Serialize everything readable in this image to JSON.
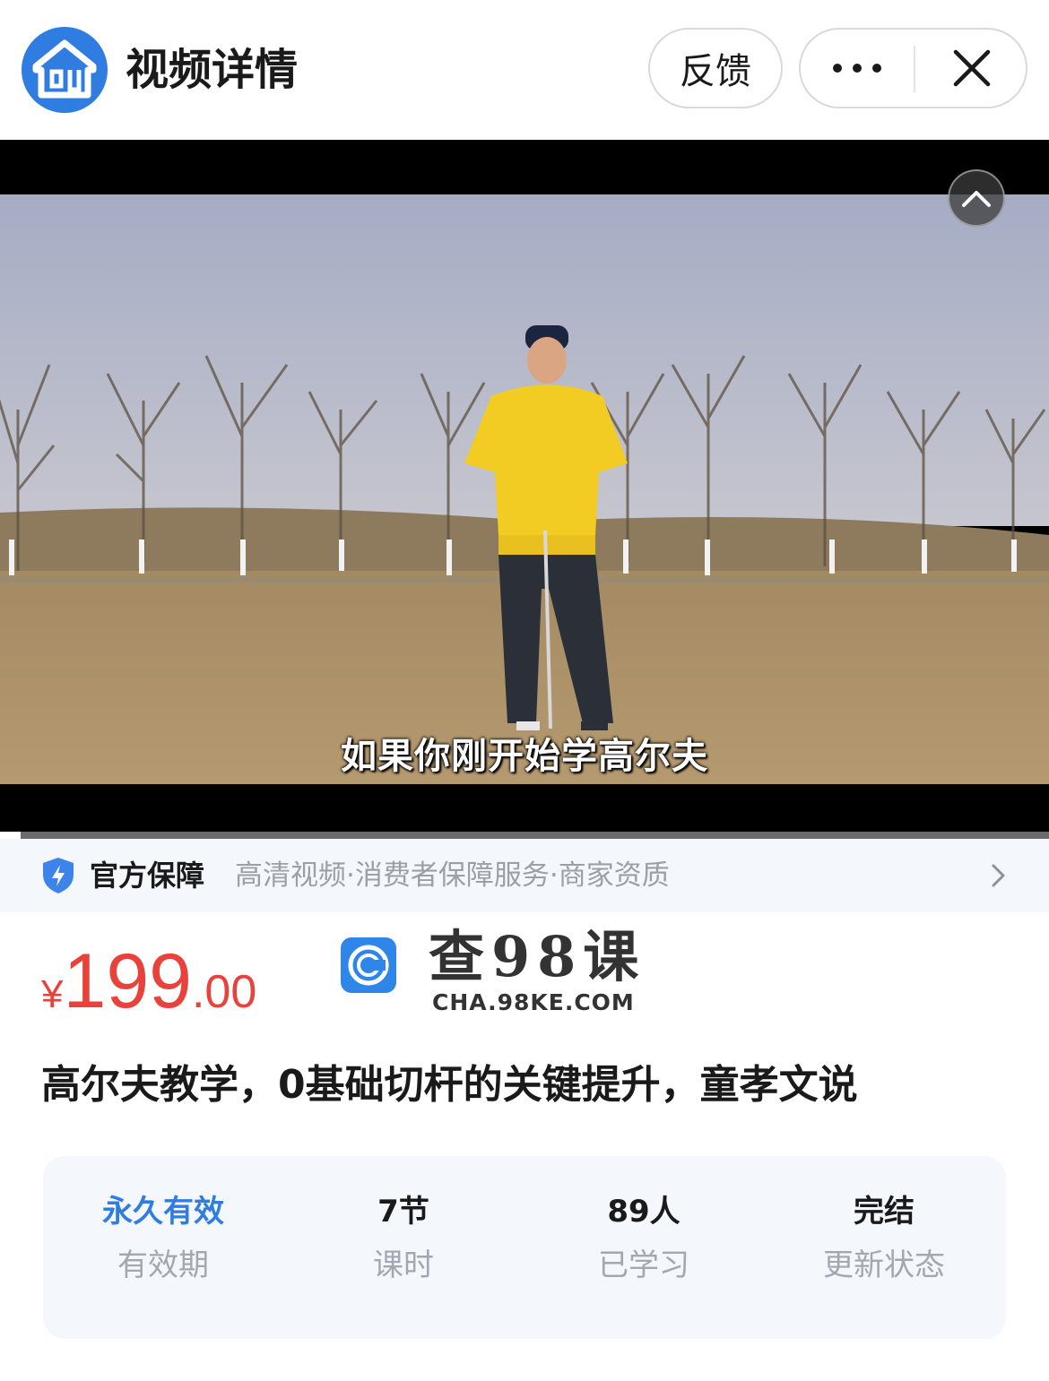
{
  "header": {
    "title": "视频详情",
    "feedback_label": "反馈"
  },
  "video": {
    "subtitle": "如果你刚开始学高尔夫",
    "progress_fraction": 0.02
  },
  "guarantee": {
    "title": "官方保障",
    "items": "高清视频·消费者保障服务·商家资质"
  },
  "price": {
    "currency": "¥",
    "integer": "199",
    "decimal": ".00"
  },
  "watermark": {
    "name": "查98课",
    "url": "CHA.98KE.COM"
  },
  "course": {
    "title": "高尔夫教学，0基础切杆的关键提升，童孝文说"
  },
  "stats": [
    {
      "value": "永久有效",
      "label": "有效期"
    },
    {
      "value": "7节",
      "label": "课时"
    },
    {
      "value": "89人",
      "label": "已学习"
    },
    {
      "value": "完结",
      "label": "更新状态"
    }
  ],
  "colors": {
    "accent": "#2f7de1",
    "price": "#e8423a",
    "muted": "#9a9fa8"
  },
  "icons": {
    "logo": "house-logo-icon",
    "more": "more-dots-icon",
    "close": "close-icon",
    "collapse": "chevron-up-icon",
    "shield": "shield-bolt-icon",
    "arrow": "chevron-right-icon"
  }
}
